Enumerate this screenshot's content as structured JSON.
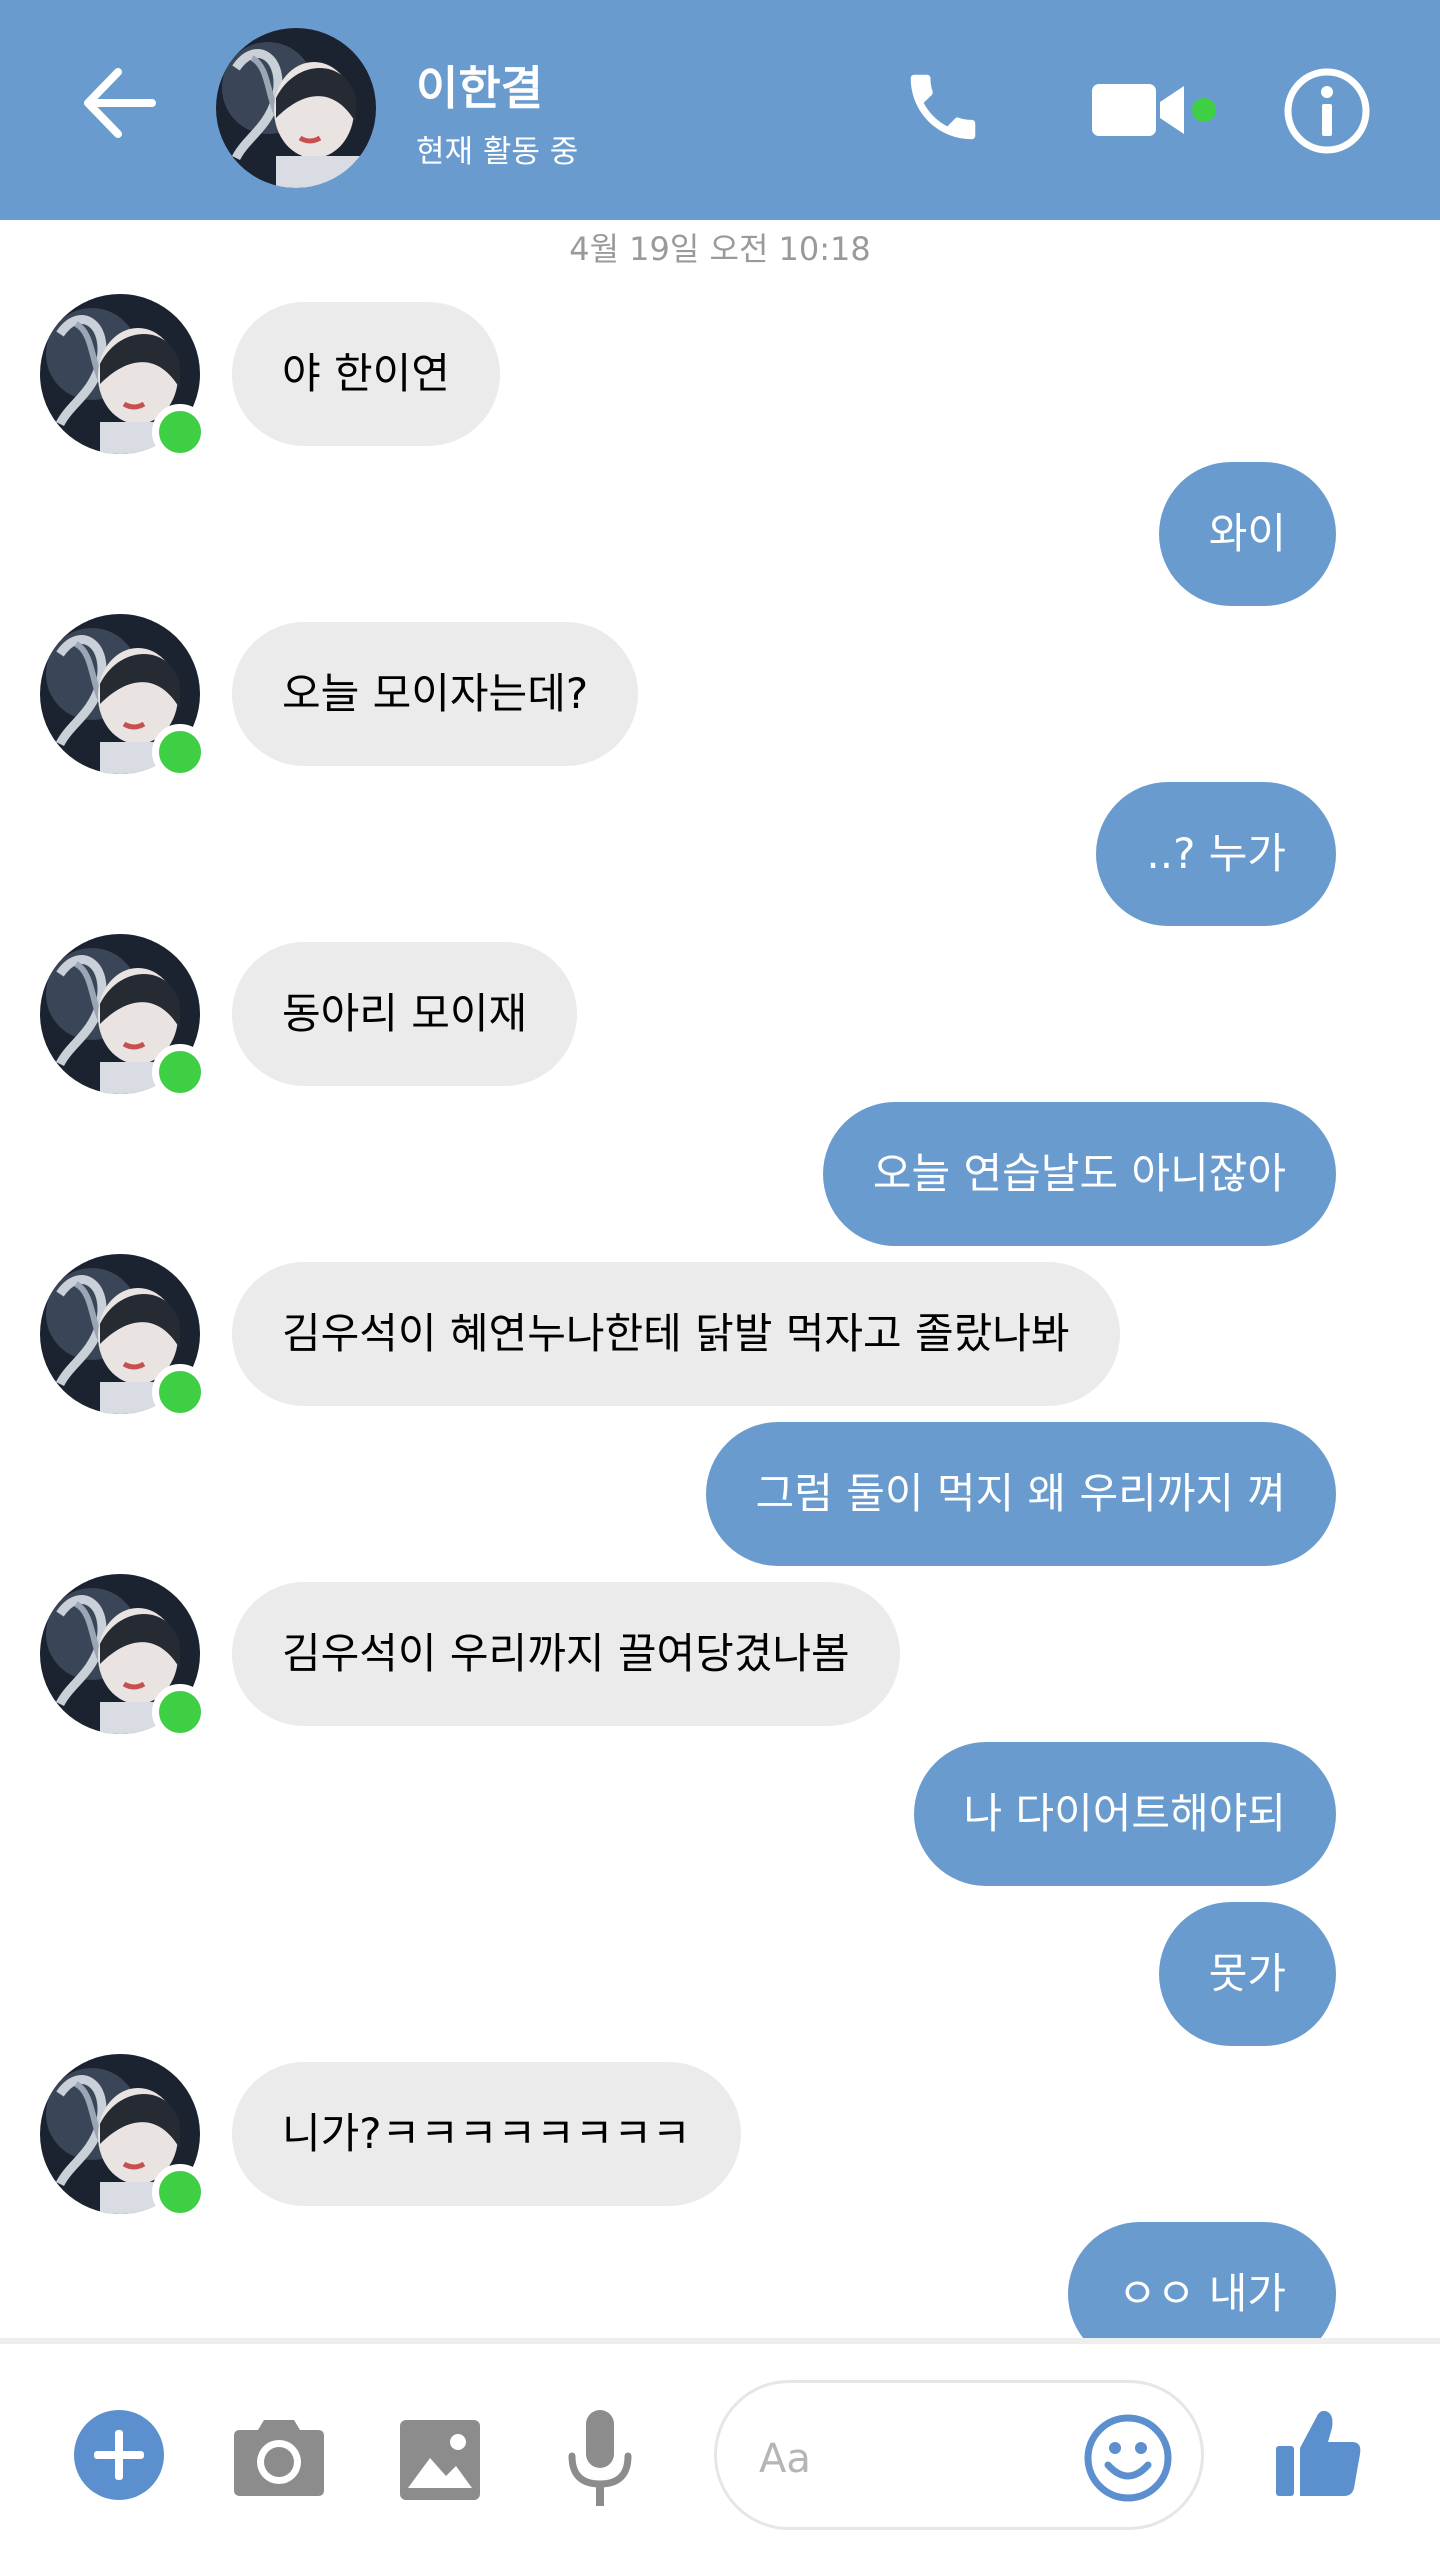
{
  "header": {
    "contact_name": "이한결",
    "status": "현재 활동 중"
  },
  "conversation": {
    "timestamp": "4월 19일 오전 10:18",
    "messages": [
      {
        "from": "them",
        "text": "야 한이연"
      },
      {
        "from": "me",
        "text": "와이"
      },
      {
        "from": "them",
        "text": "오늘 모이자는데?"
      },
      {
        "from": "me",
        "text": "..? 누가"
      },
      {
        "from": "them",
        "text": "동아리 모이재"
      },
      {
        "from": "me",
        "text": "오늘 연습날도 아니잖아"
      },
      {
        "from": "them",
        "text": "김우석이 혜연누나한테 닭발 먹자고 졸랐나봐"
      },
      {
        "from": "me",
        "text": "그럼 둘이 먹지 왜 우리까지 껴"
      },
      {
        "from": "them",
        "text": "김우석이 우리까지 끌여당겼나봄"
      },
      {
        "from": "me",
        "text": "나 다이어트해야되"
      },
      {
        "from": "me",
        "text": "못가"
      },
      {
        "from": "them",
        "text": "니가?ㅋㅋㅋㅋㅋㅋㅋㅋ"
      },
      {
        "from": "me",
        "text": "ㅇㅇ 내가"
      }
    ]
  },
  "composer": {
    "placeholder": "Aa"
  },
  "colors": {
    "header_bg": "#6a9bcf",
    "outgoing_bubble": "#6a9bcf",
    "incoming_bubble": "#ebebeb",
    "online": "#3ecf45"
  },
  "icons": [
    "back-arrow-icon",
    "phone-icon",
    "video-camera-icon",
    "info-icon",
    "plus-icon",
    "camera-icon",
    "image-icon",
    "microphone-icon",
    "emoji-icon",
    "thumbs-up-icon"
  ]
}
